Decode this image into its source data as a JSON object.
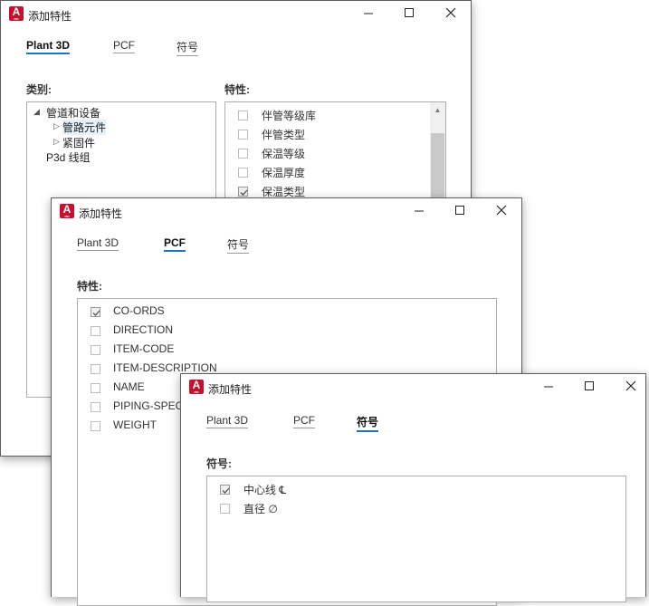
{
  "window1": {
    "title": "添加特性",
    "tabs": [
      "Plant 3D",
      "PCF",
      "符号"
    ],
    "category_label": "类别:",
    "tree": {
      "root": "管道和设备",
      "children": [
        "管路元件",
        "紧固件"
      ],
      "other": "P3d 线组"
    },
    "properties_label": "特性:",
    "properties": [
      {
        "label": "伴管等级库",
        "checked": false
      },
      {
        "label": "伴管类型",
        "checked": false
      },
      {
        "label": "保温等级",
        "checked": false
      },
      {
        "label": "保温厚度",
        "checked": false
      },
      {
        "label": "保温类型",
        "checked": true
      }
    ]
  },
  "window2": {
    "title": "添加特性",
    "tabs": [
      "Plant 3D",
      "PCF",
      "符号"
    ],
    "properties_label": "特性:",
    "properties": [
      {
        "label": "CO-ORDS",
        "checked": true
      },
      {
        "label": "DIRECTION",
        "checked": false
      },
      {
        "label": "ITEM-CODE",
        "checked": false
      },
      {
        "label": "ITEM-DESCRIPTION",
        "checked": false
      },
      {
        "label": "NAME",
        "checked": false
      },
      {
        "label": "PIPING-SPEC",
        "checked": false
      },
      {
        "label": "WEIGHT",
        "checked": false
      }
    ]
  },
  "window3": {
    "title": "添加特性",
    "tabs": [
      "Plant 3D",
      "PCF",
      "符号"
    ],
    "symbols_label": "符号:",
    "symbols": [
      {
        "label": "中心线 ℄",
        "checked": true
      },
      {
        "label": "直径 ∅",
        "checked": false
      }
    ]
  },
  "colors": {
    "accent": "#1e74c6",
    "app_icon": "#c8102e"
  }
}
